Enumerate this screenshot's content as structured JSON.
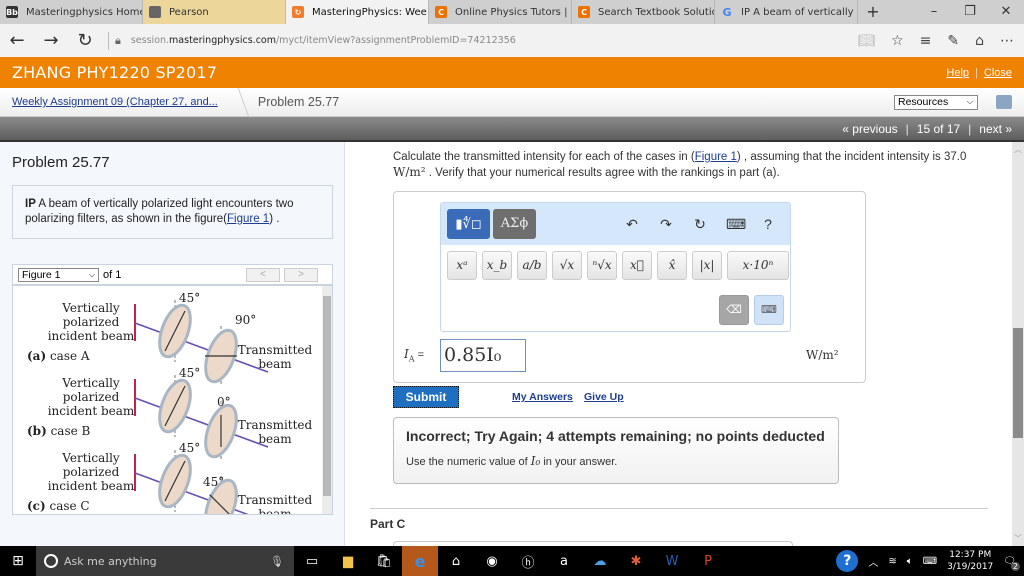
{
  "browser": {
    "tabs": [
      {
        "label": "Masteringphysics Homew",
        "icon": "blackboard-icon",
        "color": "#333333"
      },
      {
        "label": "Pearson",
        "icon": "book-icon",
        "color": "#555555"
      },
      {
        "label": "MasteringPhysics: Wee",
        "icon": "mastering-icon",
        "color": "#f07c2c",
        "active": true
      },
      {
        "label": "Online Physics Tutors | Ch",
        "icon": "chegg-icon",
        "color": "#eb7100"
      },
      {
        "label": "Search Textbook Solution",
        "icon": "chegg-icon",
        "color": "#eb7100"
      },
      {
        "label": "IP A beam of vertically pol",
        "icon": "google-icon",
        "color": "#4285f4"
      }
    ],
    "new_tab": "+",
    "close_tab": "✕",
    "win_min": "–",
    "win_restore": "❐",
    "win_close": "✕",
    "url_prefix": "session.",
    "url_domain": "masteringphysics.com",
    "url_path": "/myct/itemView?assignmentProblemID=74212356",
    "nav_back": "←",
    "nav_forward": "→",
    "nav_refresh": "↻",
    "lock": "🔒"
  },
  "header": {
    "course": "ZHANG PHY1220 SP2017",
    "help": "Help",
    "close": "Close",
    "separator": "|"
  },
  "breadcrumb": {
    "assignment": "Weekly Assignment 09 (Chapter 27, and...",
    "current": "Problem 25.77",
    "resources": "Resources"
  },
  "pager": {
    "previous": "« previous",
    "position": "15 of 17",
    "next": "next »",
    "separator": "|"
  },
  "problem": {
    "title": "Problem 25.77",
    "intro_bold": "IP",
    "intro_text": " A beam of vertically polarized light encounters two polarizing filters, as shown in the figure(",
    "intro_link": "Figure 1",
    "intro_end": ") .",
    "figure_select": "Figure 1",
    "figure_of": "of 1",
    "figure_prev": "<",
    "figure_next": ">"
  },
  "figure": {
    "cases": [
      {
        "label_bold": "(a)",
        "label": " case A",
        "first_angle": "45°",
        "second_angle": "90°",
        "second_deg": 90
      },
      {
        "label_bold": "(b)",
        "label": " case B",
        "first_angle": "45°",
        "second_angle": "0°",
        "second_deg": 0
      },
      {
        "label_bold": "(c)",
        "label": " case C",
        "first_angle": "45°",
        "second_angle": "45°",
        "second_deg": -45
      }
    ],
    "incident_line1": "Vertically",
    "incident_line2": "polarized",
    "incident_line3": "incident beam",
    "transmitted_line1": "Transmitted",
    "transmitted_line2": "beam"
  },
  "question": {
    "text1": "Calculate the transmitted intensity for each of the cases in (",
    "link": "Figure 1",
    "text2": ") , assuming that the incident intensity is 37.0",
    "unit_math": "W/m²",
    "text3": " . Verify that your numerical results agree with the rankings in part (a)."
  },
  "editor": {
    "template_btn": "▮∜◻",
    "greek_btn": "ΑΣϕ",
    "undo": "↶",
    "redo": "↷",
    "reset": "↻",
    "keyboard": "⌨",
    "help": "?",
    "buttons": [
      "xᵃ",
      "x_b",
      "a/b",
      "√x",
      "ⁿ√x",
      "x⃗",
      "x̂",
      "|x|",
      "x·10ⁿ"
    ],
    "backspace": "⌫",
    "show_keyboard": "⌨"
  },
  "answer": {
    "label_var": "I",
    "label_sub": "A",
    "label_eq": " =",
    "value": "0.85I₀",
    "unit": "W/m²"
  },
  "actions": {
    "submit": "Submit",
    "my_answers": "My Answers",
    "give_up": "Give Up"
  },
  "feedback": {
    "heading": "Incorrect; Try Again; 4 attempts remaining; no points deducted",
    "detail_pre": "Use the numeric value of ",
    "detail_var": "I₀",
    "detail_post": " in your answer."
  },
  "next_part": {
    "title": "Part C"
  },
  "taskbar": {
    "search_placeholder": "Ask me anything",
    "time": "12:37 PM",
    "date": "3/19/2017",
    "notifications": "2"
  }
}
